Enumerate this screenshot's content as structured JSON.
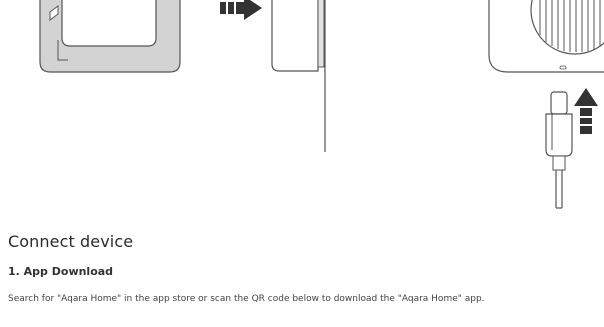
{
  "heading": "Connect device",
  "step": "1. App Download",
  "instruction": "Search for \"Aqara Home\" in the app store or scan the QR code below to download the \"Aqara Home\" app.",
  "colors": {
    "line": "#555555",
    "panel": "#d0d0d0",
    "background": "#ffffff",
    "arrow": "#333333"
  },
  "icons": [
    "device-illustration",
    "insert-arrow-icon",
    "up-arrow-icon",
    "usb-c-cable-icon"
  ]
}
